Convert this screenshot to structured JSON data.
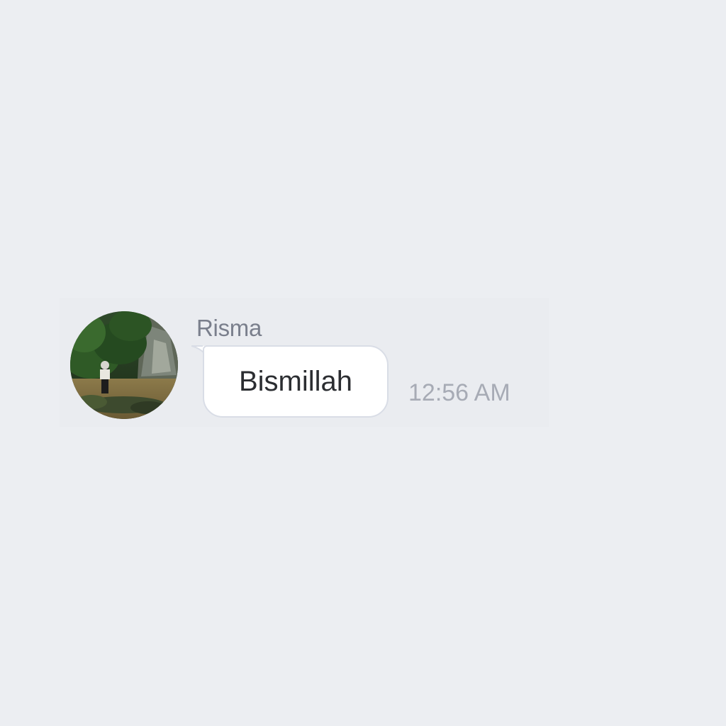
{
  "message": {
    "sender": "Risma",
    "text": "Bismillah",
    "time": "12:56 AM",
    "avatar_icon": "profile-photo-waterfall"
  },
  "colors": {
    "background": "#eceef2",
    "bubble": "#ffffff",
    "bubble_border": "#d9dde6",
    "sender_name": "#7a7f8c",
    "message_text": "#2b2d31",
    "timestamp": "#a7abb5"
  }
}
